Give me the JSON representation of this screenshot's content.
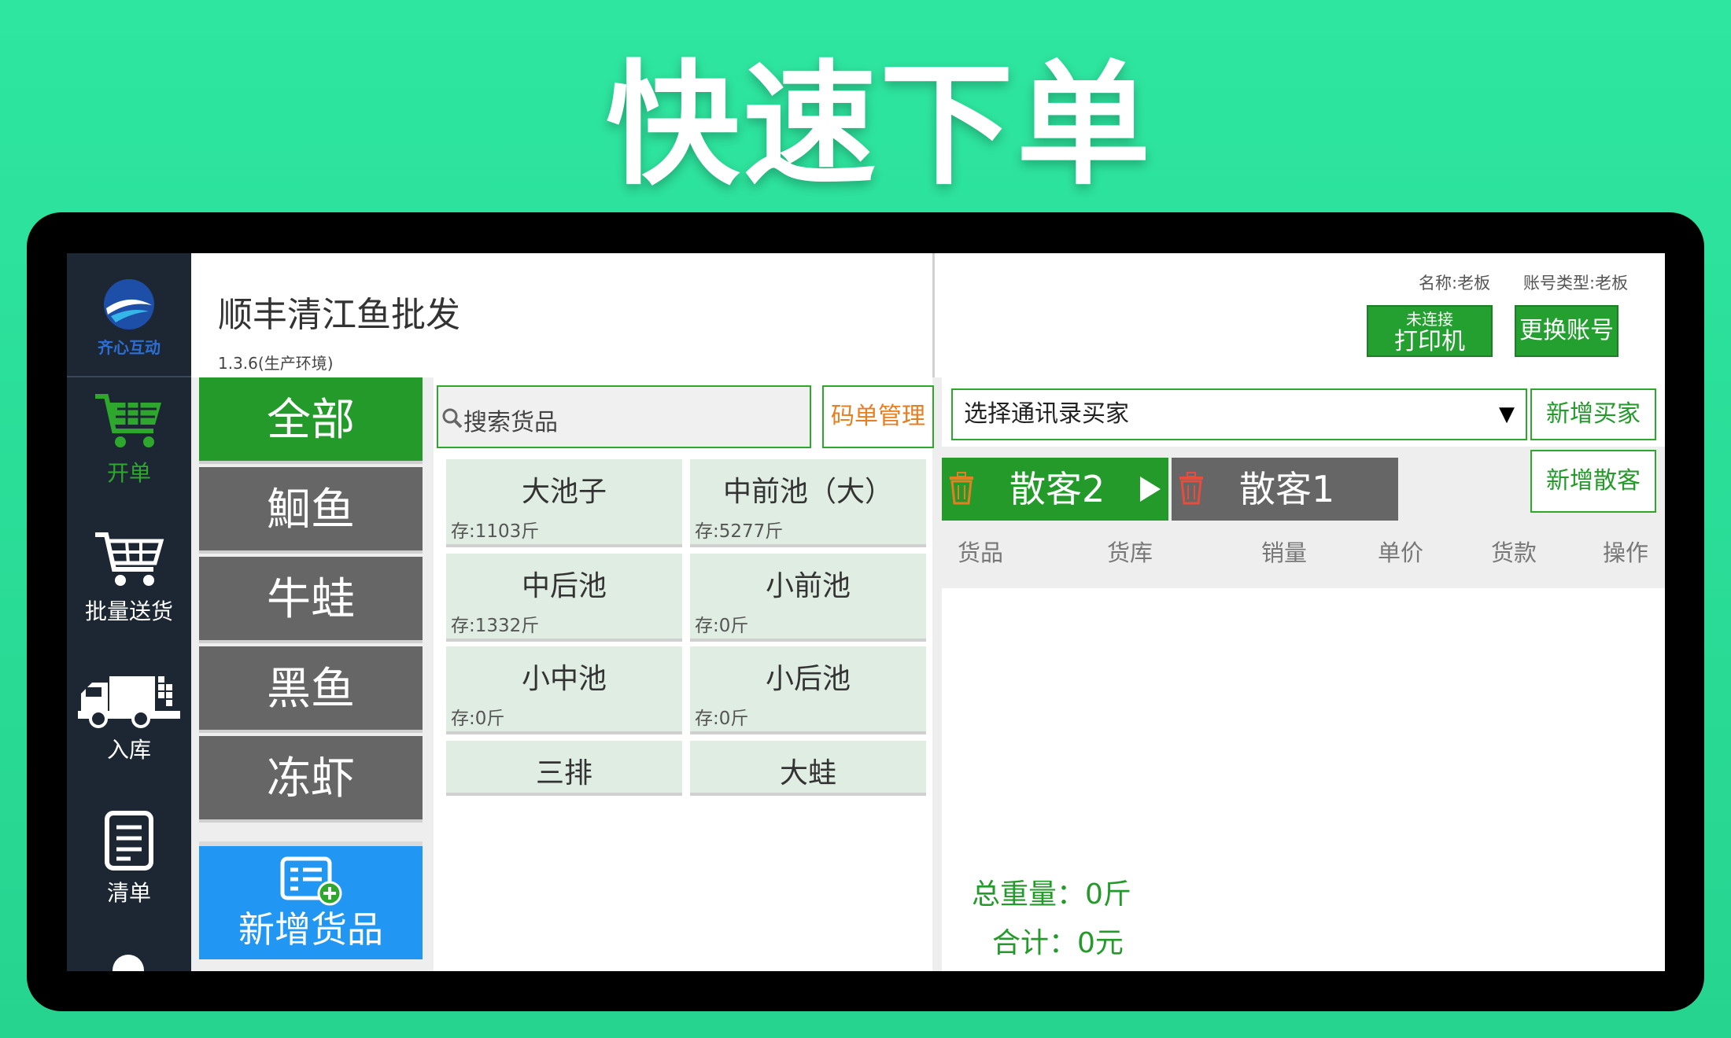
{
  "headline": "快速下单",
  "brand": {
    "logo_text": "齐心互动"
  },
  "nav": {
    "items": [
      {
        "label": "开单",
        "icon": "cart-icon",
        "active": true
      },
      {
        "label": "批量送货",
        "icon": "cart-outline-icon",
        "active": false
      },
      {
        "label": "入库",
        "icon": "truck-icon",
        "active": false
      },
      {
        "label": "清单",
        "icon": "list-doc-icon",
        "active": false
      }
    ]
  },
  "header": {
    "shop_name": "顺丰清江鱼批发",
    "version": "1.3.6(生产环境)",
    "user_name": "名称:老板",
    "account_type": "账号类型:老板",
    "printer_status": "未连接",
    "printer_label": "打印机",
    "switch_account": "更换账号"
  },
  "categories": [
    {
      "label": "全部",
      "active": true
    },
    {
      "label": "鮰鱼",
      "active": false
    },
    {
      "label": "牛蛙",
      "active": false
    },
    {
      "label": "黑鱼",
      "active": false
    },
    {
      "label": "冻虾",
      "active": false
    }
  ],
  "add_goods_label": "新增货品",
  "search": {
    "placeholder": "搜索货品"
  },
  "code_management": "码单管理",
  "goods": [
    {
      "name": "大池子",
      "stock": "存:1103斤"
    },
    {
      "name": "中前池（大）",
      "stock": "存:5277斤"
    },
    {
      "name": "中后池",
      "stock": "存:1332斤"
    },
    {
      "name": "小前池",
      "stock": "存:0斤"
    },
    {
      "name": "小中池",
      "stock": "存:0斤"
    },
    {
      "name": "小后池",
      "stock": "存:0斤"
    },
    {
      "name": "三排",
      "stock": ""
    },
    {
      "name": "大蛙",
      "stock": ""
    }
  ],
  "order": {
    "buyer_select": "选择通讯录买家",
    "add_buyer": "新增买家",
    "add_walkin": "新增散客",
    "customers": [
      {
        "label": "散客2",
        "active": true
      },
      {
        "label": "散客1",
        "active": false
      }
    ],
    "columns": [
      "货品",
      "货库",
      "销量",
      "单价",
      "货款",
      "操作"
    ],
    "total_weight": "总重量：0斤",
    "total_amount": "合计：0元"
  },
  "colors": {
    "primary_green": "#239a2a",
    "accent_blue": "#2196f3",
    "nav_bg": "#1d2733",
    "code_orange": "#e67e22"
  }
}
